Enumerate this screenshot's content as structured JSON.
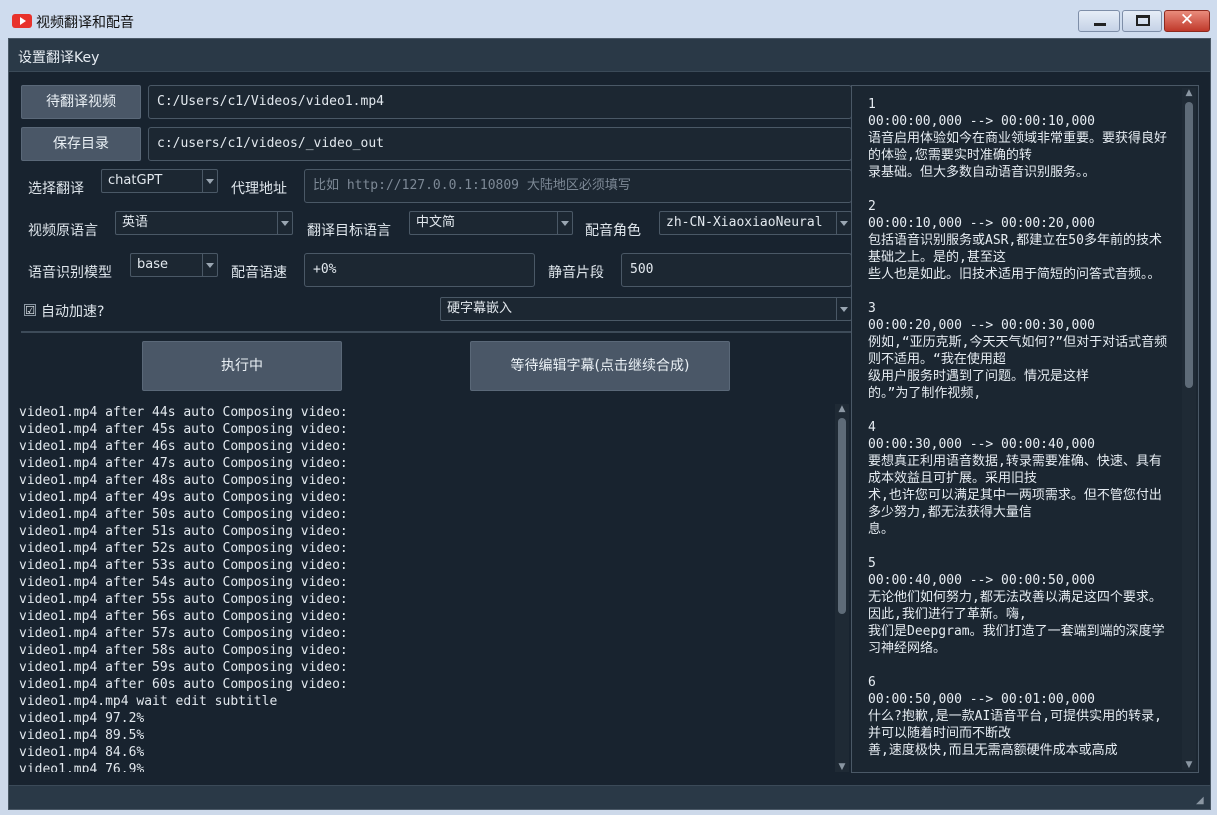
{
  "window": {
    "title": "视频翻译和配音",
    "close_glyph": "✕"
  },
  "menu": {
    "settings": "设置翻译Key"
  },
  "form": {
    "video_button": "待翻译视频",
    "video_path": "C:/Users/c1/Videos/video1.mp4",
    "save_dir_button": "保存目录",
    "save_dir_path": "c:/users/c1/videos/_video_out",
    "translate_label": "选择翻译",
    "translate_value": "chatGPT",
    "proxy_label": "代理地址",
    "proxy_placeholder": "比如 http://127.0.0.1:10809 大陆地区必须填写",
    "source_lang_label": "视频原语言",
    "source_lang_value": "英语",
    "target_lang_label": "翻译目标语言",
    "target_lang_value": "中文简",
    "voice_role_label": "配音角色",
    "voice_role_value": "zh-CN-XiaoxiaoNeural",
    "asr_model_label": "语音识别模型",
    "asr_model_value": "base",
    "voice_rate_label": "配音语速",
    "voice_rate_value": "+0%",
    "silence_label": "静音片段",
    "silence_value": "500",
    "auto_speed_check": "☑",
    "auto_speed_label": "自动加速?",
    "subtitle_mode_value": "硬字幕嵌入",
    "run_button": "执行中",
    "continue_button": "等待编辑字幕(点击继续合成)"
  },
  "log_lines": [
    "video1.mp4 after 44s auto Composing video:",
    "video1.mp4 after 45s auto Composing video:",
    "video1.mp4 after 46s auto Composing video:",
    "video1.mp4 after 47s auto Composing video:",
    "video1.mp4 after 48s auto Composing video:",
    "video1.mp4 after 49s auto Composing video:",
    "video1.mp4 after 50s auto Composing video:",
    "video1.mp4 after 51s auto Composing video:",
    "video1.mp4 after 52s auto Composing video:",
    "video1.mp4 after 53s auto Composing video:",
    "video1.mp4 after 54s auto Composing video:",
    "video1.mp4 after 55s auto Composing video:",
    "video1.mp4 after 56s auto Composing video:",
    "video1.mp4 after 57s auto Composing video:",
    "video1.mp4 after 58s auto Composing video:",
    "video1.mp4 after 59s auto Composing video:",
    "video1.mp4 after 60s auto Composing video:",
    "video1.mp4.mp4 wait edit subtitle",
    "video1.mp4 97.2%",
    "video1.mp4 89.5%",
    "video1.mp4 84.6%",
    "video1.mp4 76.9%"
  ],
  "subtitles_text": "1\n00:00:00,000 --> 00:00:10,000\n语音启用体验如今在商业领域非常重要。要获得良好的体验,您需要实时准确的转\n录基础。但大多数自动语音识别服务。。\n\n2\n00:00:10,000 --> 00:00:20,000\n包括语音识别服务或ASR,都建立在50多年前的技术基础之上。是的,甚至这\n些人也是如此。旧技术适用于简短的问答式音频。。\n\n3\n00:00:20,000 --> 00:00:30,000\n例如,“亚历克斯,今天天气如何?”但对于对话式音频则不适用。“我在使用超\n级用户服务时遇到了问题。情况是这样\n的。”为了制作视频,\n\n4\n00:00:30,000 --> 00:00:40,000\n要想真正利用语音数据,转录需要准确、快速、具有成本效益且可扩展。采用旧技\n术,也许您可以满足其中一两项需求。但不管您付出多少努力,都无法获得大量信\n息。\n\n5\n00:00:40,000 --> 00:00:50,000\n无论他们如何努力,都无法改善以满足这四个要求。因此,我们进行了革新。嗨,\n我们是Deepgram。我们打造了一套端到端的深度学习神经网络。\n\n6\n00:00:50,000 --> 00:01:00,000\n什么?抱歉,是一款AI语音平台,可提供实用的转录,并可以随着时间而不断改\n善,速度极快,而且无需高额硬件成本或高成"
}
